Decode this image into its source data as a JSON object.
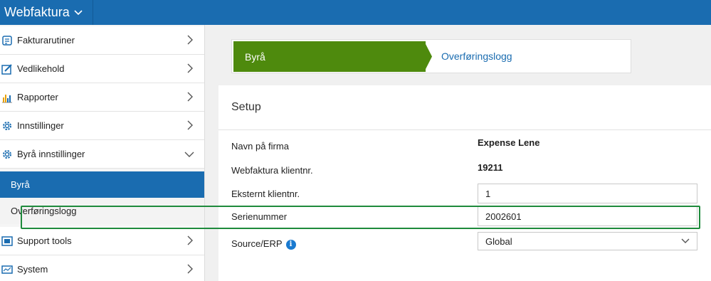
{
  "app": {
    "title": "Webfaktura"
  },
  "sidebar": {
    "items": [
      {
        "label": "Fakturarutiner",
        "icon": "invoice-icon"
      },
      {
        "label": "Vedlikehold",
        "icon": "edit-icon"
      },
      {
        "label": "Rapporter",
        "icon": "bar-chart-icon"
      },
      {
        "label": "Innstillinger",
        "icon": "gear-icon"
      },
      {
        "label": "Byrå innstillinger",
        "icon": "gear-icon",
        "expanded": true
      },
      {
        "label": "Support tools",
        "icon": "support-icon"
      },
      {
        "label": "System",
        "icon": "monitor-icon"
      }
    ],
    "subitems": [
      {
        "label": "Byrå",
        "active": true
      },
      {
        "label": "Overføringslogg",
        "active": false
      }
    ]
  },
  "wizard": {
    "active_step": "Byrå",
    "next_step": "Overføringslogg",
    "active_color": "#4e8a0d"
  },
  "setup": {
    "title": "Setup",
    "fields": {
      "firma": {
        "label": "Navn på firma",
        "value": "Expense Lene"
      },
      "klientnr": {
        "label": "Webfaktura klientnr.",
        "value": "19211"
      },
      "ekstern": {
        "label": "Eksternt klientnr.",
        "value": "1"
      },
      "serienummer": {
        "label": "Serienummer",
        "value": "2002601"
      },
      "source": {
        "label": "Source/ERP",
        "value": "Global"
      }
    }
  },
  "colors": {
    "brand": "#1a6cb0",
    "highlight": "#1e8a3c"
  }
}
